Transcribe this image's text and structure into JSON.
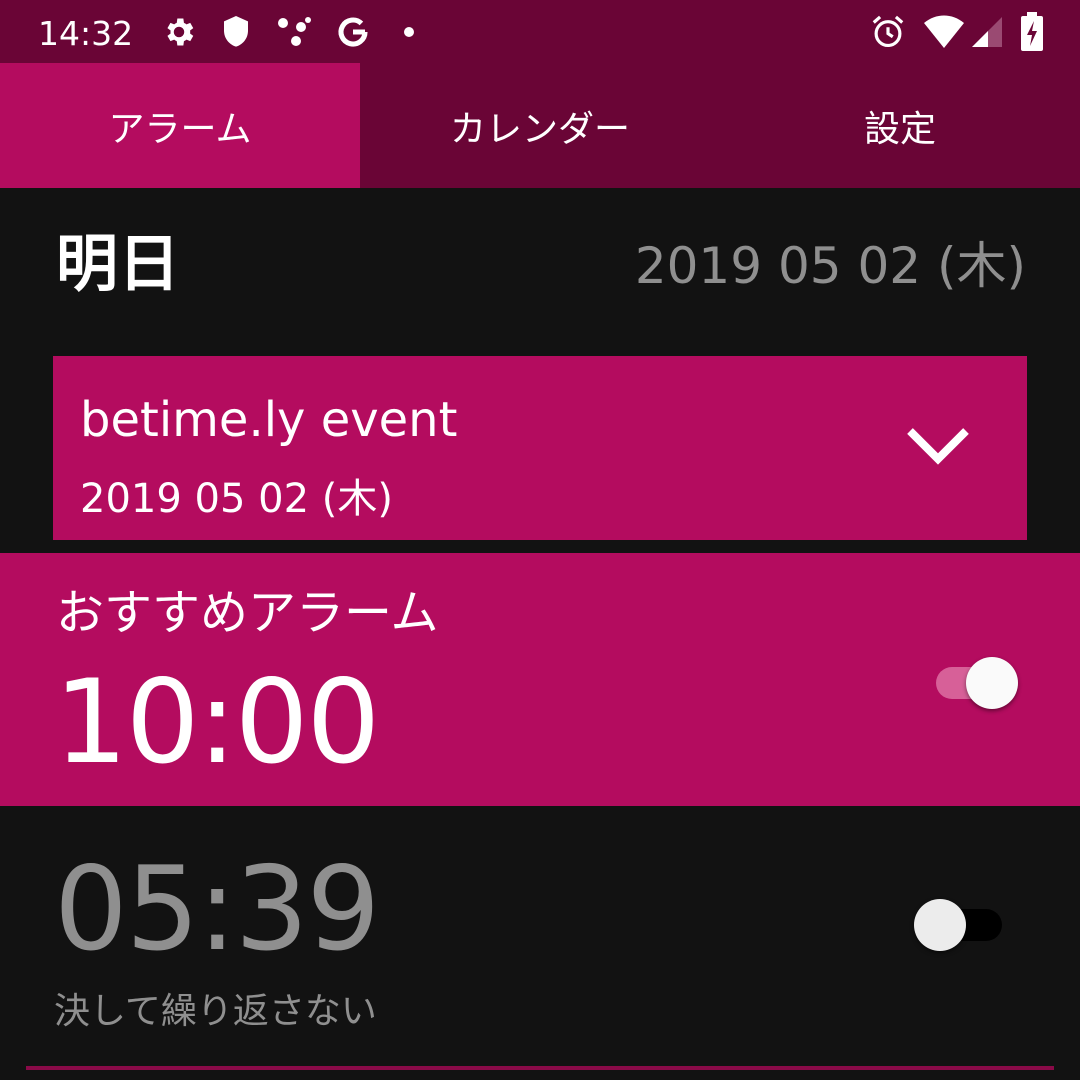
{
  "status_bar": {
    "time": "14:32",
    "left_icons": [
      "gear-icon",
      "shield-icon",
      "assistant-dots-icon",
      "google-g-icon",
      "notification-dot-icon"
    ],
    "right_icons": [
      "alarm-clock-icon",
      "wifi-icon",
      "cell-signal-icon",
      "battery-charging-icon"
    ]
  },
  "tabs": [
    {
      "label": "アラーム",
      "active": true
    },
    {
      "label": "カレンダー",
      "active": false
    },
    {
      "label": "設定",
      "active": false
    }
  ],
  "day": {
    "title": "明日",
    "date": "2019 05 02 (木)"
  },
  "event": {
    "title": "betime.ly event",
    "date": "2019 05 02 (木)",
    "expand_icon": "chevron-down-icon"
  },
  "recommended_alarm": {
    "title": "おすすめアラーム",
    "time": "10:00",
    "enabled": true
  },
  "alarm": {
    "time": "05:39",
    "repeat": "決して繰り返さない",
    "enabled": false
  },
  "colors": {
    "primary_dark": "#6a0536",
    "accent": "#b40c5f",
    "background": "#121212",
    "muted_text": "#8f8f8f"
  }
}
